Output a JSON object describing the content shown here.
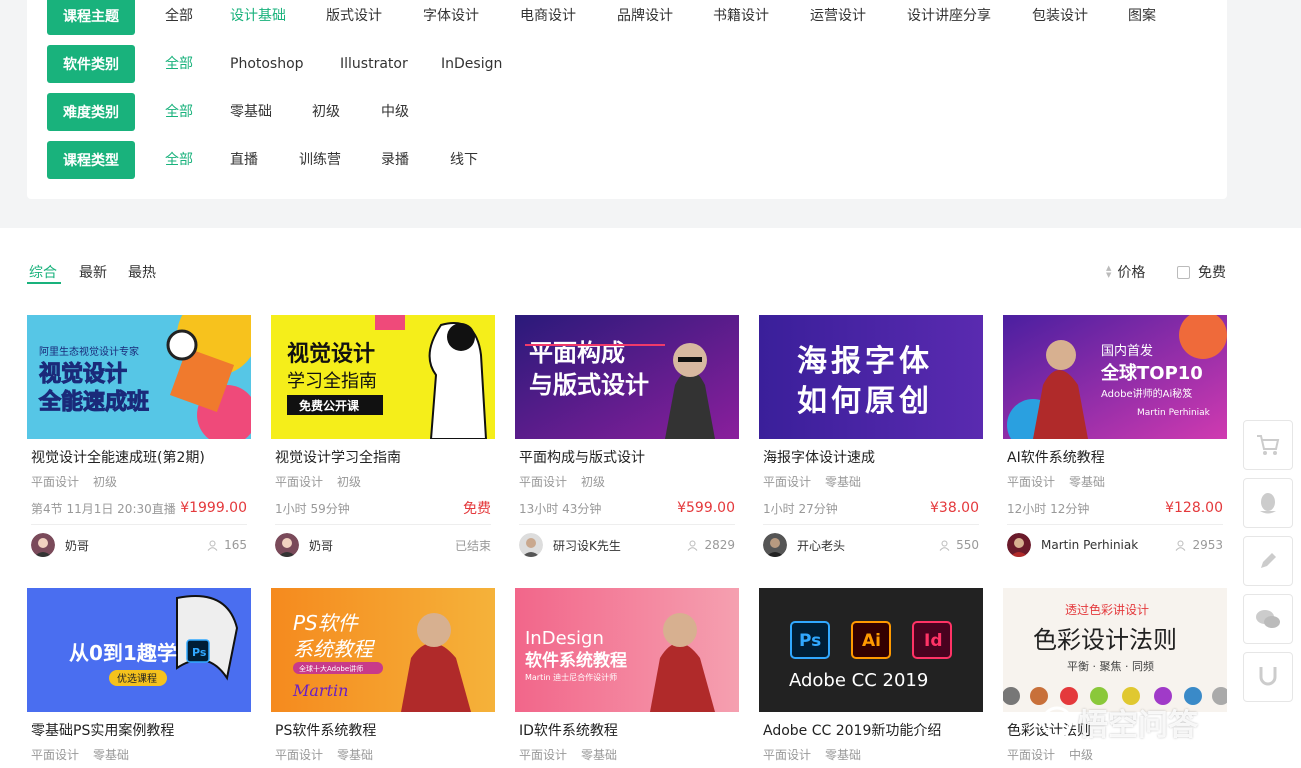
{
  "filters": [
    {
      "tag": "课程主题",
      "options": [
        "全部",
        "设计基础",
        "版式设计",
        "字体设计",
        "电商设计",
        "品牌设计",
        "书籍设计",
        "运营设计",
        "设计讲座分享",
        "包装设计",
        "图案"
      ],
      "active": 1
    },
    {
      "tag": "软件类别",
      "options": [
        "全部",
        "Photoshop",
        "Illustrator",
        "InDesign"
      ],
      "active": 0
    },
    {
      "tag": "难度类别",
      "options": [
        "全部",
        "零基础",
        "初级",
        "中级"
      ],
      "active": 0
    },
    {
      "tag": "课程类型",
      "options": [
        "全部",
        "直播",
        "训练营",
        "录播",
        "线下"
      ],
      "active": 0
    }
  ],
  "sort": {
    "tabs": [
      "综合",
      "最新",
      "最热"
    ],
    "price_label": "价格",
    "free_label": "免费"
  },
  "courses": [
    {
      "title": "视觉设计全能速成班(第2期)",
      "category": "平面设计",
      "level": "初级",
      "info": "第4节 11月1日 20:30直播",
      "price": "¥1999.00",
      "author": "奶哥",
      "views": "165",
      "thumb": {
        "bg": "#56c6e6",
        "line1": "阿里生态视觉设计专家",
        "line2": "视觉设计",
        "line3": "全能速成班"
      }
    },
    {
      "title": "视觉设计学习全指南",
      "category": "平面设计",
      "level": "初级",
      "info": "1小时 59分钟",
      "price": "免费",
      "author": "奶哥",
      "status": "已结束",
      "thumb": {
        "bg": "#f5ee1a",
        "line1": "视觉设计",
        "line2": "学习全指南",
        "line3": "免费公开课"
      }
    },
    {
      "title": "平面构成与版式设计",
      "category": "平面设计",
      "level": "初级",
      "info": "13小时 43分钟",
      "price": "¥599.00",
      "author": "研习设K先生",
      "views": "2829",
      "thumb": {
        "bg": "#4a1f8c",
        "line1": "平面构成",
        "line2": "与版式设计"
      }
    },
    {
      "title": "海报字体设计速成",
      "category": "平面设计",
      "level": "零基础",
      "info": "1小时 27分钟",
      "price": "¥38.00",
      "author": "开心老头",
      "views": "550",
      "thumb": {
        "bg": "#3a1f9a",
        "line1": "海报字体",
        "line2": "如何原创"
      }
    },
    {
      "title": "AI软件系统教程",
      "category": "平面设计",
      "level": "零基础",
      "info": "12小时 12分钟",
      "price": "¥128.00",
      "author": "Martin Perhiniak",
      "views": "2953",
      "thumb": {
        "bg": "#6a1fc4",
        "line1": "国内首发",
        "line2": "全球TOP10",
        "line3": "Adobe讲师的Ai秘笈",
        "line4": "Martin Perhiniak"
      }
    },
    {
      "title": "零基础PS实用案例教程",
      "category": "平面设计",
      "level": "零基础",
      "thumb": {
        "bg": "#4a6ef0",
        "line1": "从0到1趣学",
        "line2": "优选课程",
        "badge": "Ps"
      }
    },
    {
      "title": "PS软件系统教程",
      "category": "平面设计",
      "level": "零基础",
      "thumb": {
        "bg": "#f58a1e",
        "line1": "PS软件",
        "line2": "系统教程",
        "line3": "全球十大Adobe讲师",
        "line4": "Martin"
      }
    },
    {
      "title": "ID软件系统教程",
      "category": "平面设计",
      "level": "零基础",
      "thumb": {
        "bg": "#f2668a",
        "line1": "InDesign",
        "line2": "软件系统教程",
        "line3": "Martin 迪士尼合作设计师"
      }
    },
    {
      "title": "Adobe CC 2019新功能介绍",
      "category": "平面设计",
      "level": "零基础",
      "thumb": {
        "bg": "#222222",
        "line1": "Adobe CC 2019",
        "badges": [
          "Ps",
          "Ai",
          "Id"
        ]
      }
    },
    {
      "title": "色彩设计法则",
      "category": "平面设计",
      "level": "中级",
      "thumb": {
        "bg": "#f7f3ee",
        "line1": "透过色彩讲设计",
        "line2": "色彩设计法则",
        "line3": "平衡 · 聚焦 · 同频"
      }
    }
  ],
  "watermark": "悟空问答",
  "colors": {
    "accent": "#19b27c",
    "price": "#e4393c"
  }
}
